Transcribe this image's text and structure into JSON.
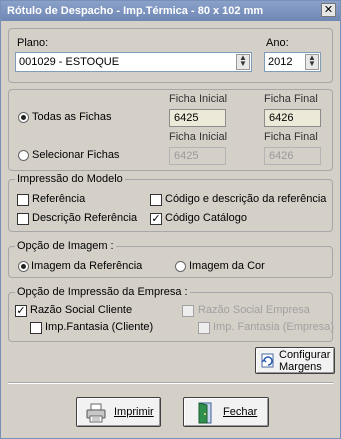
{
  "window": {
    "title": "Rótulo de Despacho - Imp.Térmica - 80 x 102 mm",
    "close_glyph": "✕"
  },
  "plano": {
    "label": "Plano:",
    "value": "001029 - ESTOQUE"
  },
  "ano": {
    "label": "Ano:",
    "value": "2012"
  },
  "fichas": {
    "todas_label": "Todas as Fichas",
    "selecionar_label": "Selecionar Fichas",
    "ficha_inicial_label": "Ficha Inicial",
    "ficha_final_label": "Ficha Final",
    "todas_inicial": "6425",
    "todas_final": "6426",
    "sel_inicial": "6425",
    "sel_final": "6426",
    "selected": "todas"
  },
  "impressao_modelo": {
    "title": "Impressão do Modelo",
    "referencia": {
      "label": "Referência",
      "checked": false
    },
    "codigo_descricao": {
      "label": "Código e descrição da referência",
      "checked": false
    },
    "descricao_referencia": {
      "label": "Descrição Referência",
      "checked": false
    },
    "codigo_catalogo": {
      "label": "Código Catálogo",
      "checked": true
    }
  },
  "opcao_imagem": {
    "title": "Opção de Imagem :",
    "imagem_referencia": "Imagem da Referência",
    "imagem_cor": "Imagem da Cor",
    "selected": "referencia"
  },
  "opcao_empresa": {
    "title": "Opção de Impressão da Empresa :",
    "razao_cliente": {
      "label": "Razão Social Cliente",
      "checked": true
    },
    "fantasia_cliente": {
      "label": "Imp.Fantasia (Cliente)",
      "checked": false
    },
    "razao_empresa": {
      "label": "Razão Social Empresa",
      "checked": false
    },
    "fantasia_empresa": {
      "label": "Imp. Fantasia (Empresa)",
      "checked": false
    }
  },
  "buttons": {
    "configurar_line1": "Configurar",
    "configurar_line2": "Margens",
    "imprimir": "Imprimir",
    "fechar": "Fechar"
  },
  "icons": {
    "spinner_up": "▲",
    "spinner_down": "▼",
    "check_glyph": "✓"
  },
  "colors": {
    "title_bar": "#7b93c0",
    "window_bg": "#d4d0c8"
  }
}
